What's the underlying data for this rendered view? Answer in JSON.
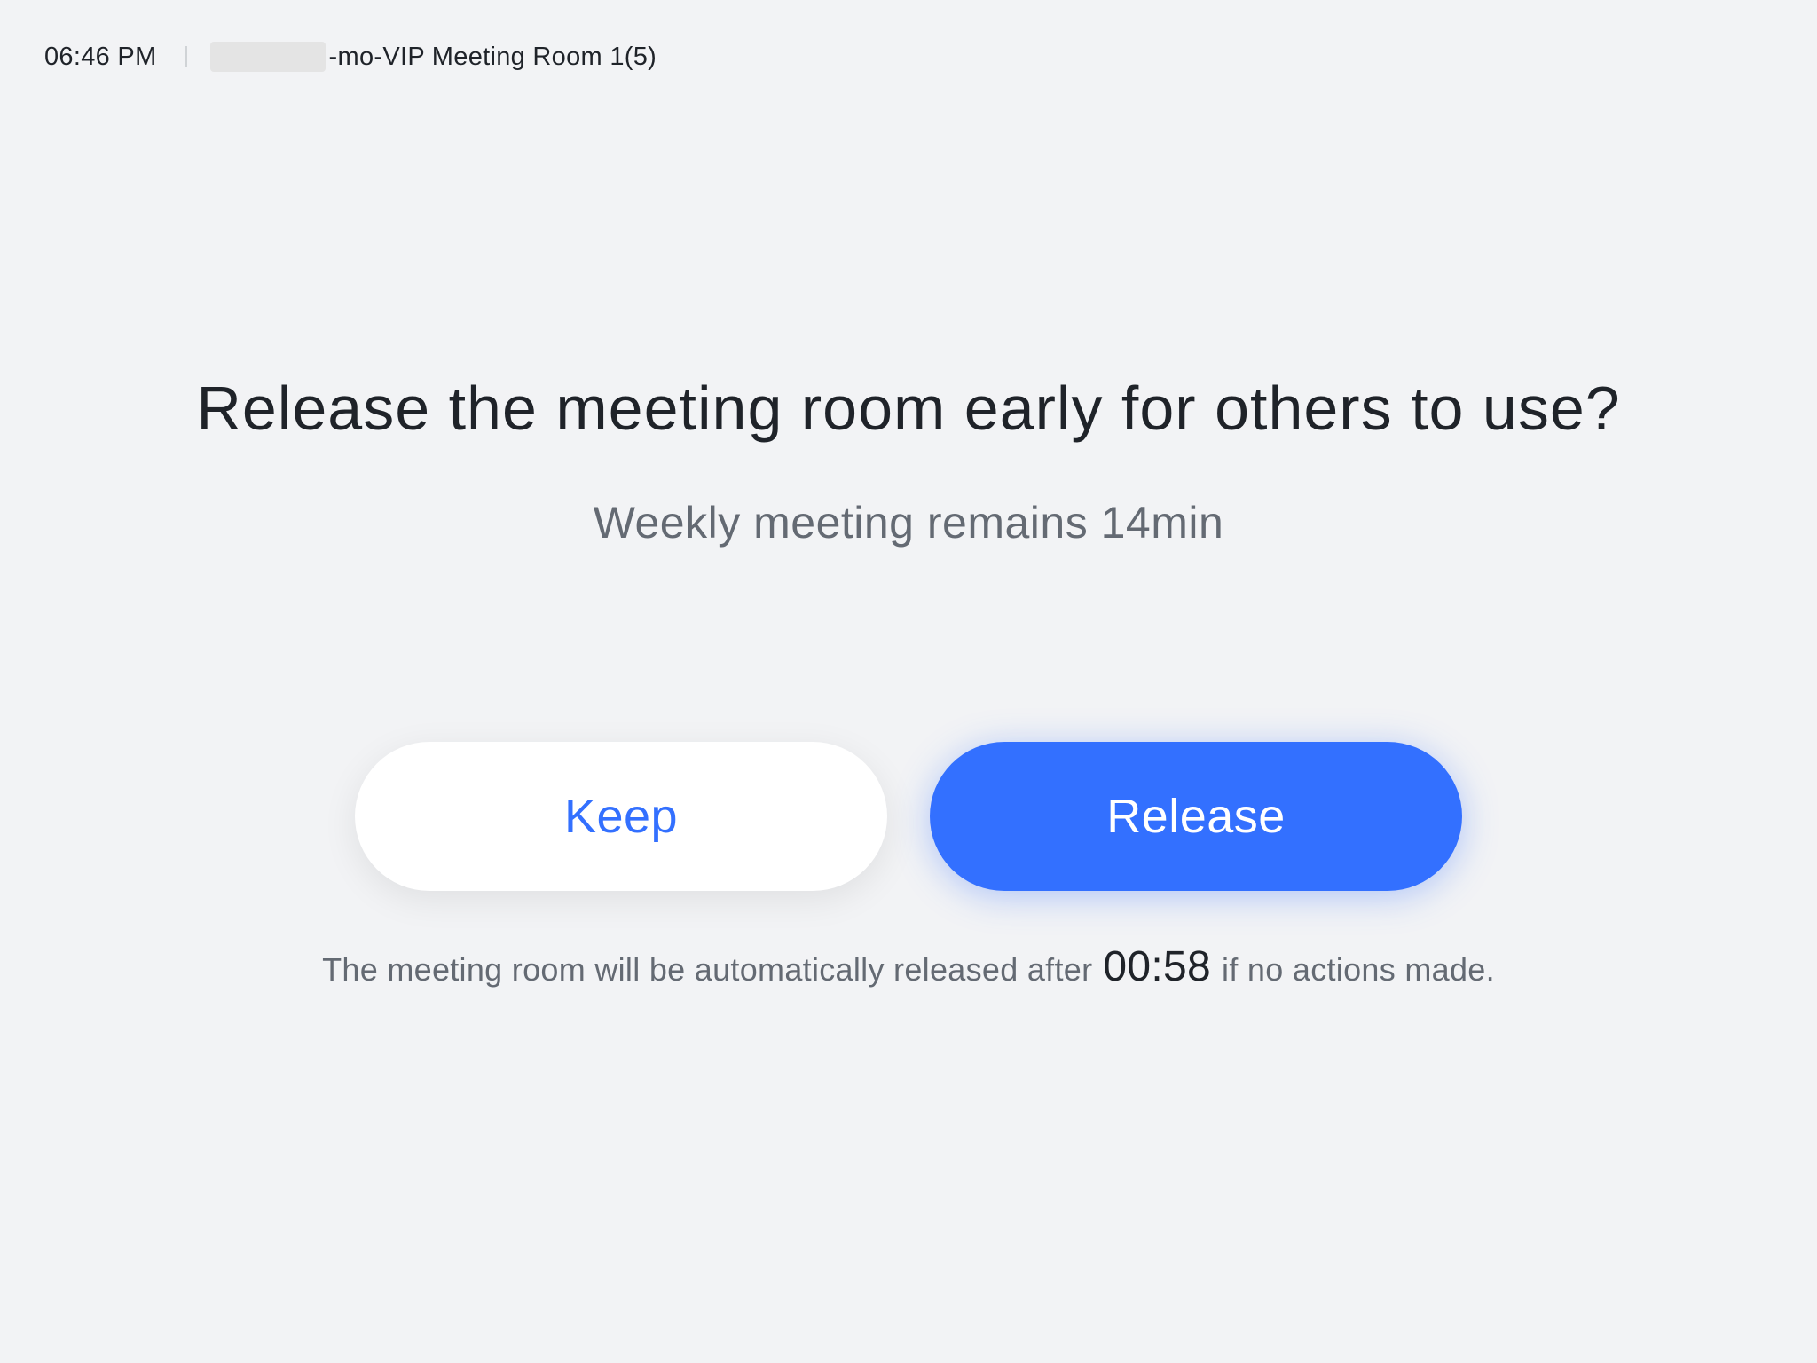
{
  "status_bar": {
    "time": "06:46 PM",
    "room_name": "-mo-VIP Meeting Room 1(5)"
  },
  "dialog": {
    "title": "Release the meeting room early for others to use?",
    "subtitle": "Weekly meeting remains 14min",
    "keep_label": "Keep",
    "release_label": "Release",
    "footnote_before": "The meeting room will be automatically released after",
    "countdown": "00:58",
    "footnote_after": "if no actions made."
  },
  "colors": {
    "background": "#f2f3f5",
    "accent": "#3370ff",
    "text_primary": "#1f2329",
    "text_secondary": "#646a73"
  }
}
